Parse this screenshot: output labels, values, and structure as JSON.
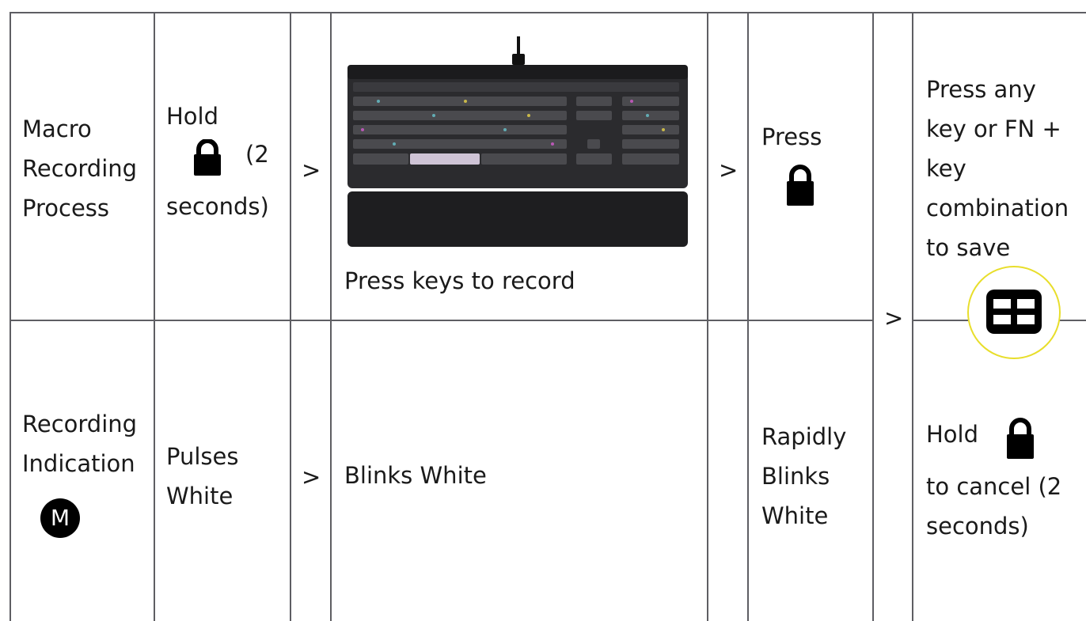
{
  "rows": {
    "macro_process": {
      "label_lines": [
        "Macro",
        "Recording",
        "Process"
      ],
      "hold": {
        "word": "Hold",
        "paren": "(2",
        "tail": "seconds)",
        "icon": "lock-icon"
      },
      "separator": ">",
      "keyboard_image": {
        "icon": "keyboard-image"
      },
      "press_keys": "Press keys to record",
      "separator2": ">",
      "press": {
        "word": "Press",
        "icon": "lock-icon"
      },
      "save_lines": [
        "Press any",
        "key or FN +",
        "key",
        "combination",
        "to save"
      ]
    },
    "recording_indication": {
      "label_lines": [
        "Recording",
        "Indication"
      ],
      "badge": "M",
      "pulses_lines": [
        "Pulses",
        "White"
      ],
      "separator": ">",
      "blinks": "Blinks White",
      "rapid_lines": [
        "Rapidly",
        "Blinks",
        "White"
      ],
      "cancel": {
        "word": "Hold",
        "lines": [
          "to cancel (2",
          "seconds)"
        ],
        "icon": "lock-icon"
      }
    }
  },
  "shared_separator": ">",
  "grid_badge_icon": "grid-icon",
  "colors": {
    "line": "#5e5e63",
    "badge_ring": "#e8de2b",
    "text": "#1a1a1a"
  }
}
